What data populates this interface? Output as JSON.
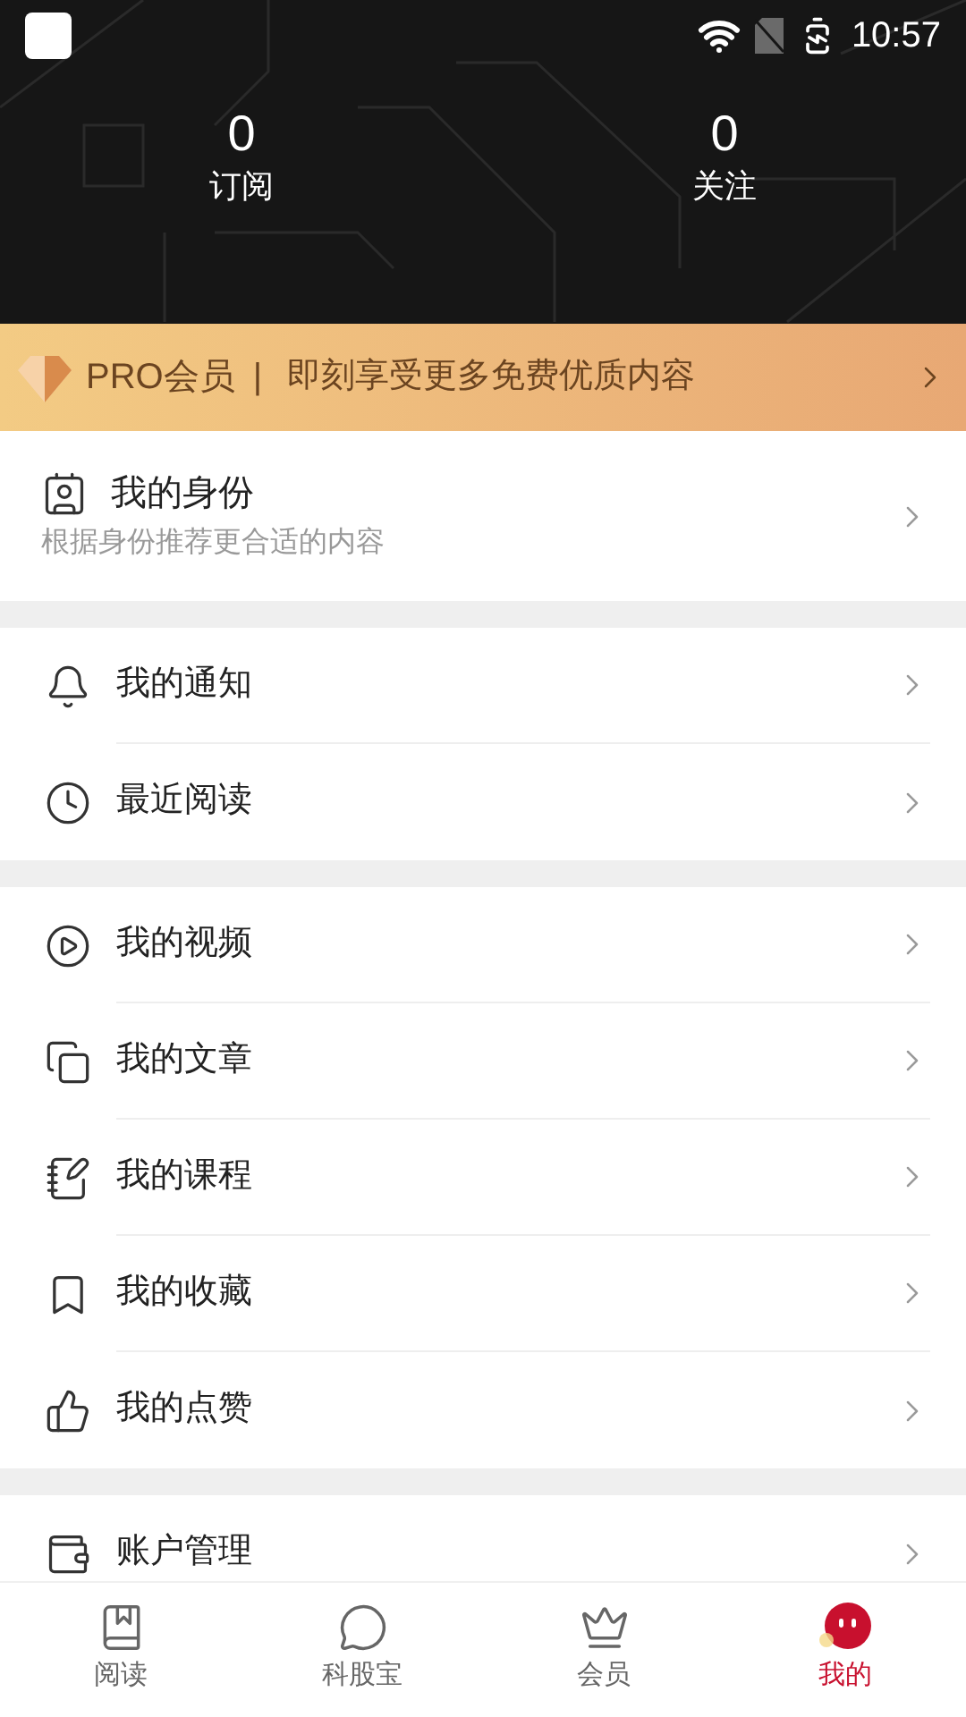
{
  "status_bar": {
    "time": "10:57"
  },
  "stats": [
    {
      "value": "0",
      "label": "订阅"
    },
    {
      "value": "0",
      "label": "关注"
    }
  ],
  "pro_banner": {
    "title": "PRO会员",
    "separator": "|",
    "text": "即刻享受更多免费优质内容"
  },
  "identity": {
    "title": "我的身份",
    "subtitle": "根据身份推荐更合适的内容"
  },
  "groups": [
    {
      "items": [
        "我的通知",
        "最近阅读"
      ]
    },
    {
      "items": [
        "我的视频",
        "我的文章",
        "我的课程",
        "我的收藏",
        "我的点赞"
      ]
    },
    {
      "items": [
        "账户管理"
      ]
    }
  ],
  "bottom_nav": [
    {
      "label": "阅读",
      "selected": false
    },
    {
      "label": "科股宝",
      "selected": false
    },
    {
      "label": "会员",
      "selected": false
    },
    {
      "label": "我的",
      "selected": true
    }
  ]
}
